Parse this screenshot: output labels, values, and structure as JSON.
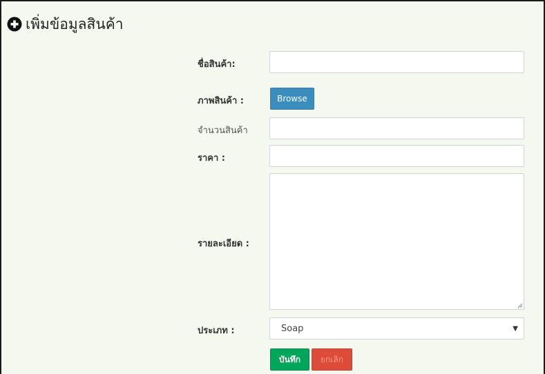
{
  "header": {
    "title": "เพิ่มข้อมูลสินค้า",
    "icon": "plus-circle-icon"
  },
  "form": {
    "name_label": "ชื่อสินค้า:",
    "name_value": "",
    "image_label": "ภาพสินค้า :",
    "browse_label": "Browse",
    "quantity_label": "จำนวนสินค้า",
    "quantity_value": "",
    "price_label": "ราคา :",
    "price_value": "",
    "detail_label": "รายละเอียด :",
    "detail_value": "",
    "category_label": "ประเภท :",
    "category_selected": "Soap",
    "save_label": "บันทึก",
    "cancel_label": "ยกเลิก"
  },
  "colors": {
    "background": "#f5f8ef",
    "browse": "#3b8dbd",
    "save": "#00a65a",
    "cancel": "#dd4b39"
  }
}
